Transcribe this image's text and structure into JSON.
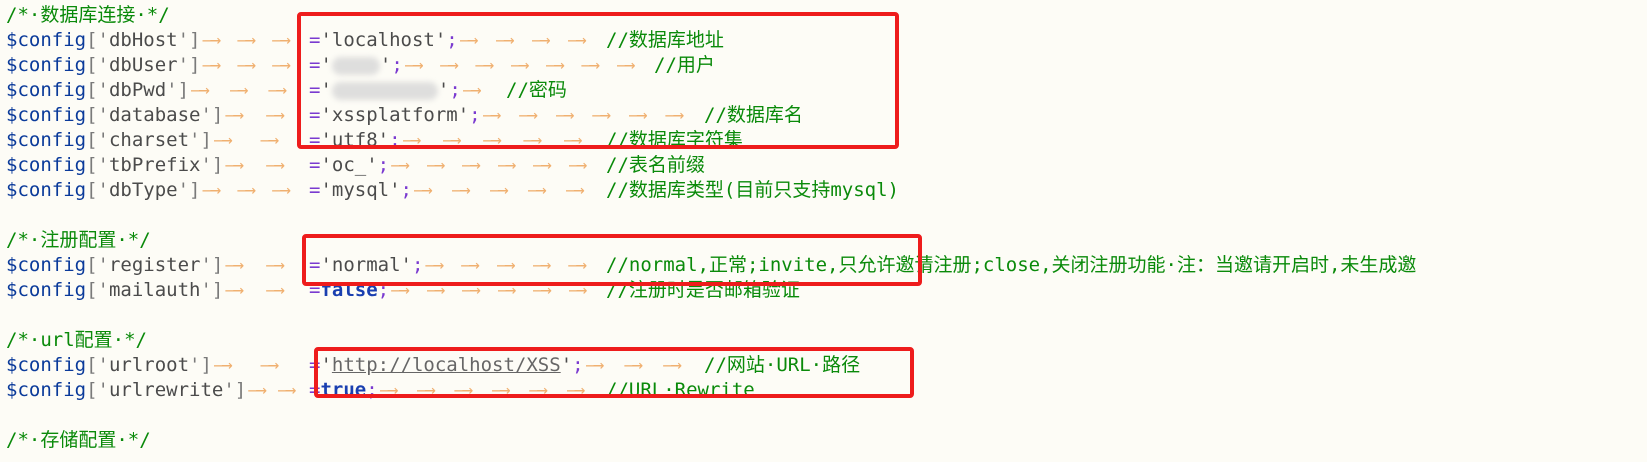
{
  "lines": [
    {
      "kind": "comment",
      "text": "/*·数据库连接·*/"
    },
    {
      "kind": "config",
      "key": "dbHost",
      "value": "'localhost'",
      "value_type": "string",
      "comment": "//数据库地址"
    },
    {
      "kind": "config",
      "key": "dbUser",
      "value": "'",
      "value_type": "redacted",
      "comment": "//用户"
    },
    {
      "kind": "config",
      "key": "dbPwd",
      "value": "'",
      "value_type": "redacted",
      "comment": "//密码"
    },
    {
      "kind": "config",
      "key": "database",
      "value": "'xssplatform'",
      "value_type": "string",
      "comment": "//数据库名"
    },
    {
      "kind": "config",
      "key": "charset",
      "value": "'utf8'",
      "value_type": "string",
      "comment": "//数据库字符集"
    },
    {
      "kind": "config",
      "key": "tbPrefix",
      "value": "'oc_'",
      "value_type": "string",
      "comment": "//表名前缀"
    },
    {
      "kind": "config",
      "key": "dbType",
      "value": "'mysql'",
      "value_type": "string",
      "comment": "//数据库类型(目前只支持mysql)"
    },
    {
      "kind": "blank"
    },
    {
      "kind": "comment",
      "text": "/*·注册配置·*/"
    },
    {
      "kind": "config",
      "key": "register",
      "value": "'normal'",
      "value_type": "string",
      "comment": "//normal,正常;invite,只允许邀请注册;close,关闭注册功能·注：当邀请开启时,未生成邀"
    },
    {
      "kind": "config",
      "key": "mailauth",
      "value": "false",
      "value_type": "keyword",
      "comment": "//注册时是否邮箱验证"
    },
    {
      "kind": "blank"
    },
    {
      "kind": "comment",
      "text": "/*·url配置·*/"
    },
    {
      "kind": "config",
      "key": "urlroot",
      "value": "'http://localhost/XSS'",
      "value_type": "url",
      "comment": "//网站·URL·路径"
    },
    {
      "kind": "config",
      "key": "urlrewrite",
      "value": "true",
      "value_type": "keyword",
      "comment": "//URL·Rewrite"
    },
    {
      "kind": "blank"
    },
    {
      "kind": "comment",
      "text": "/*·存储配置·*/"
    }
  ],
  "syntax": {
    "var_prefix": "$config",
    "open_bracket": "['",
    "close_bracket": "']",
    "assign": "=",
    "semicolon": ";",
    "tab_glyph": "—→"
  },
  "colors": {
    "background": "#fdfcf6",
    "comment": "#0a8a0a",
    "variable": "#0a3a9a",
    "keyword": "#1a3fb0",
    "operator": "#7a3ad0",
    "tab_marker": "#f0b070",
    "highlight_box": "#ee1c1c"
  }
}
